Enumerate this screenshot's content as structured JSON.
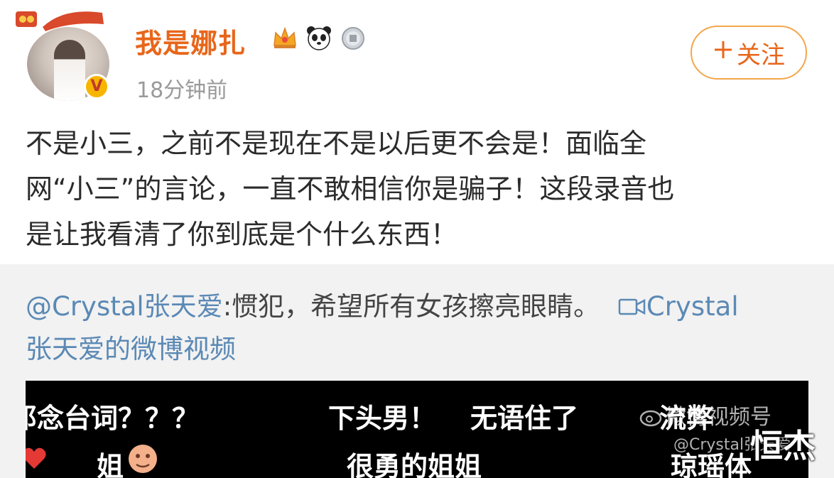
{
  "post": {
    "username": "我是娜扎",
    "timestamp": "18分钟前",
    "follow_label": "关注",
    "follow_icon": "plus-icon",
    "badges": [
      "crown-icon",
      "panda-icon",
      "medal-icon"
    ],
    "content_lines": [
      "不是小三，之前不是现在不是以后更不会是！面临全",
      "网“小三”的言论，一直不敢相信你是骗子！这段录音也",
      "是让我看清了你到底是个什么东西！"
    ]
  },
  "repost": {
    "mention": "@Crystal张天爱",
    "text": ":惯犯，希望所有女孩擦亮眼睛。",
    "video_link_line1": "Crystal",
    "video_link_line2": "张天爱的微博视频",
    "video_icon": "video-icon"
  },
  "video": {
    "danmaku": [
      "邓念台词？？？",
      "下头男！",
      "无语住了",
      "流弊",
      "姐",
      "很勇的姐姐",
      "琼瑶体"
    ],
    "watermark_channel": "微博视频号",
    "watermark_handle": "@Crystal张天爱"
  },
  "corner_watermark": "恒杰",
  "colors": {
    "username": "#e8661a",
    "link": "#5b89b5",
    "follow_border": "#f3a64b",
    "repost_bg": "#f2f2f2"
  }
}
